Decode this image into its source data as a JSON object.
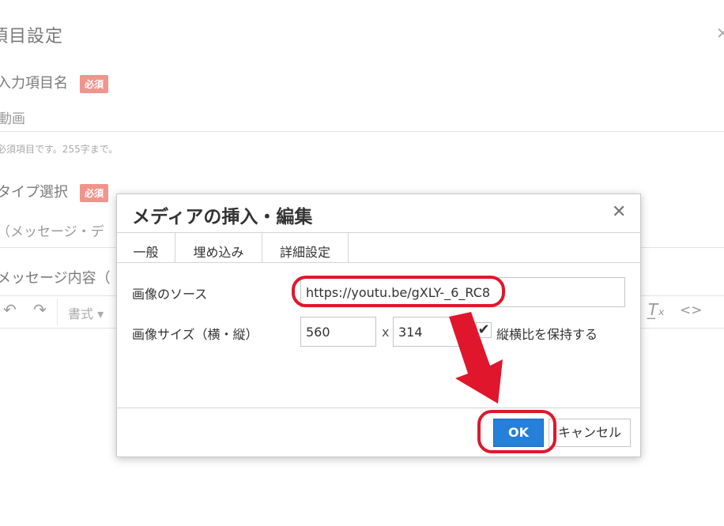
{
  "background": {
    "title": "項目設定",
    "field1": {
      "label": "入力項目名",
      "badge": "必須",
      "value": "動画",
      "help": "必須項目です。255字まで。"
    },
    "field2": {
      "label": "タイプ選択",
      "badge": "必須",
      "value": "（メッセージ・デ"
    },
    "field3": {
      "label": "メッセージ内容（"
    },
    "toolbar": {
      "format_label": "書式"
    }
  },
  "dialog": {
    "title": "メディアの挿入・編集",
    "tabs": [
      {
        "label": "一般"
      },
      {
        "label": "埋め込み"
      },
      {
        "label": "詳細設定"
      }
    ],
    "source": {
      "label": "画像のソース",
      "value": "https://youtu.be/gXLY-_6_RC8"
    },
    "size": {
      "label": "画像サイズ（横・縦）",
      "width": "560",
      "separator": "x",
      "height": "314"
    },
    "constrain": {
      "label": "縦横比を保持する",
      "checked": true
    },
    "buttons": {
      "ok": "OK",
      "cancel": "キャンセル"
    }
  },
  "annotations": {
    "highlight_color": "#e0172c"
  }
}
